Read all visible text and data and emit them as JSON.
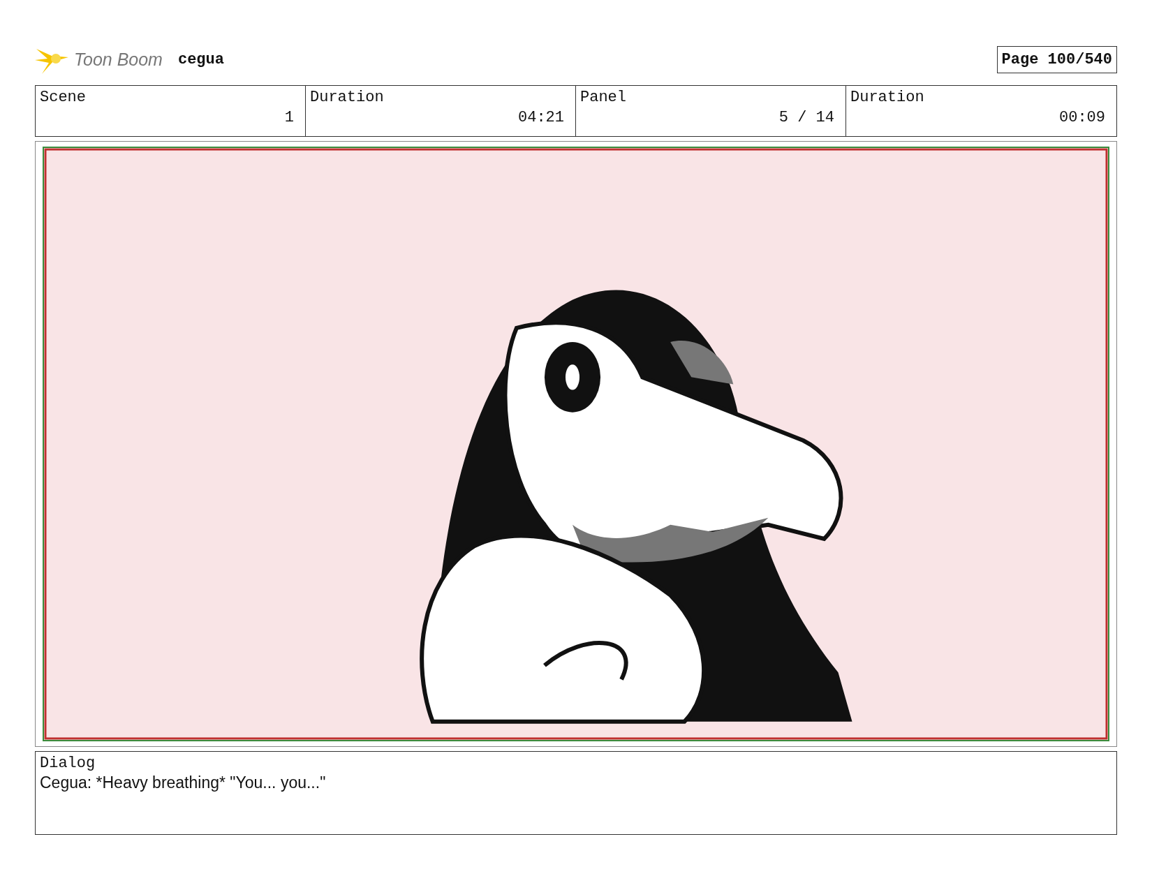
{
  "header": {
    "logo_text": "Toon Boom",
    "project": "cegua",
    "page": "Page 100/540"
  },
  "fields": [
    {
      "label": "Scene",
      "value": "1"
    },
    {
      "label": "Duration",
      "value": "04:21"
    },
    {
      "label": "Panel",
      "value": "5 / 14"
    },
    {
      "label": "Duration",
      "value": "00:09"
    }
  ],
  "dialog": {
    "label": "Dialog",
    "text": "Cegua: *Heavy breathing* \"You... you...\""
  }
}
